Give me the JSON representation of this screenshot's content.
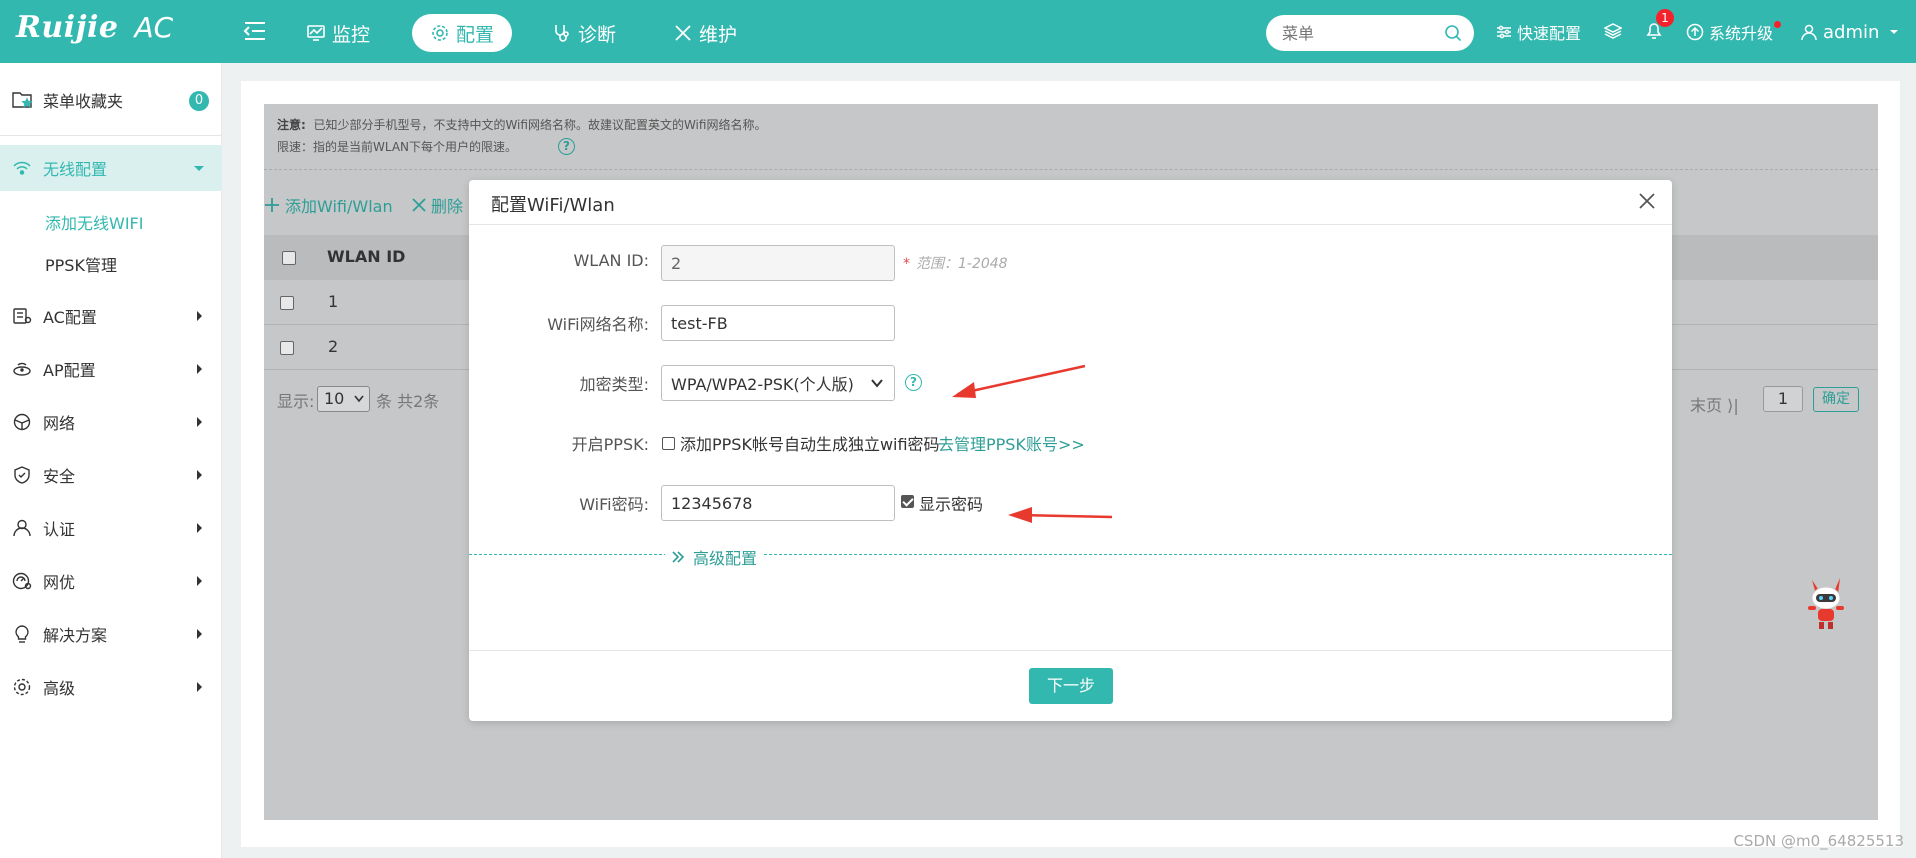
{
  "header": {
    "brand": "Ruijie",
    "brand_suffix": "AC",
    "nav": [
      {
        "label": "监控",
        "icon": "monitor-icon"
      },
      {
        "label": "配置",
        "icon": "gear-icon"
      },
      {
        "label": "诊断",
        "icon": "stethoscope-icon"
      },
      {
        "label": "维护",
        "icon": "tools-icon"
      }
    ],
    "search_placeholder": "菜单",
    "quick_config": "快速配置",
    "notification_count": "1",
    "upgrade": "系统升级",
    "user": "admin",
    "accent_color": "#33b8b0"
  },
  "sidebar": {
    "favorites_label": "菜单收藏夹",
    "favorites_count": "0",
    "items": [
      {
        "label": "无线配置",
        "icon": "wifi-icon",
        "active": true
      },
      {
        "label": "AC配置",
        "icon": "ac-icon"
      },
      {
        "label": "AP配置",
        "icon": "ap-icon"
      },
      {
        "label": "网络",
        "icon": "network-icon"
      },
      {
        "label": "安全",
        "icon": "shield-icon"
      },
      {
        "label": "认证",
        "icon": "user-icon"
      },
      {
        "label": "网优",
        "icon": "optimize-icon"
      },
      {
        "label": "解决方案",
        "icon": "lightbulb-icon"
      },
      {
        "label": "高级",
        "icon": "settings-icon"
      }
    ],
    "sub_items": [
      {
        "label": "添加无线WIFI",
        "active": true
      },
      {
        "label": "PPSK管理"
      }
    ]
  },
  "notice": {
    "line1_prefix": "注意:",
    "line1": "已知少部分手机型号，不支持中文的Wifi网络名称。故建议配置英文的Wifi网络名称。",
    "line2": "限速：指的是当前WLAN下每个用户的限速。"
  },
  "toolbar": {
    "add": "添加Wifi/Wlan",
    "delete": "删除"
  },
  "table": {
    "headers": [
      "WLAN ID"
    ],
    "rows": [
      [
        "1"
      ],
      [
        "2"
      ]
    ],
    "show_label": "显示:",
    "page_size": "10",
    "total": "条 共2条",
    "last_page": "末页",
    "page_input": "1",
    "confirm": "确定"
  },
  "dialog": {
    "title": "配置WiFi/Wlan",
    "fields": {
      "wlan_id_label": "WLAN ID:",
      "wlan_id_value": "2",
      "wlan_id_hint": "范围：1-2048",
      "ssid_label": "WiFi网络名称:",
      "ssid_value": "test-FB",
      "encryption_label": "加密类型:",
      "encryption_value": "WPA/WPA2-PSK(个人版)",
      "ppsk_label": "开启PPSK:",
      "ppsk_text": "添加PPSK帐号自动生成独立wifi密码",
      "ppsk_link": "去管理PPSK账号>>",
      "password_label": "WiFi密码:",
      "password_value": "12345678",
      "show_password": "显示密码"
    },
    "advanced": "高级配置",
    "next": "下一步"
  },
  "watermark": "CSDN @m0_64825513",
  "annotation_color": "#e8392f"
}
